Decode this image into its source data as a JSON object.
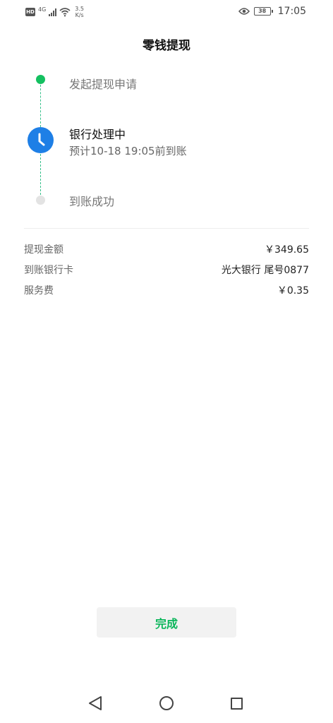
{
  "status_bar": {
    "hd": "HD",
    "network": "4G",
    "speed_value": "3.5",
    "speed_unit": "K/s",
    "battery": "38",
    "time": "17:05"
  },
  "header": {
    "title": "零钱提现"
  },
  "timeline": {
    "steps": [
      {
        "label": "发起提现申请",
        "state": "done"
      },
      {
        "label": "银行处理中",
        "sub": "预计10-18 19:05前到账",
        "state": "active"
      },
      {
        "label": "到账成功",
        "state": "pending"
      }
    ]
  },
  "details": [
    {
      "label": "提现金额",
      "value": "￥349.65"
    },
    {
      "label": "到账银行卡",
      "value": "光大银行 尾号0877"
    },
    {
      "label": "服务费",
      "value": "￥0.35"
    }
  ],
  "actions": {
    "done_label": "完成"
  },
  "colors": {
    "accent_green": "#14c060",
    "clock_blue": "#1e7fe6",
    "button_text": "#0ab55a"
  }
}
